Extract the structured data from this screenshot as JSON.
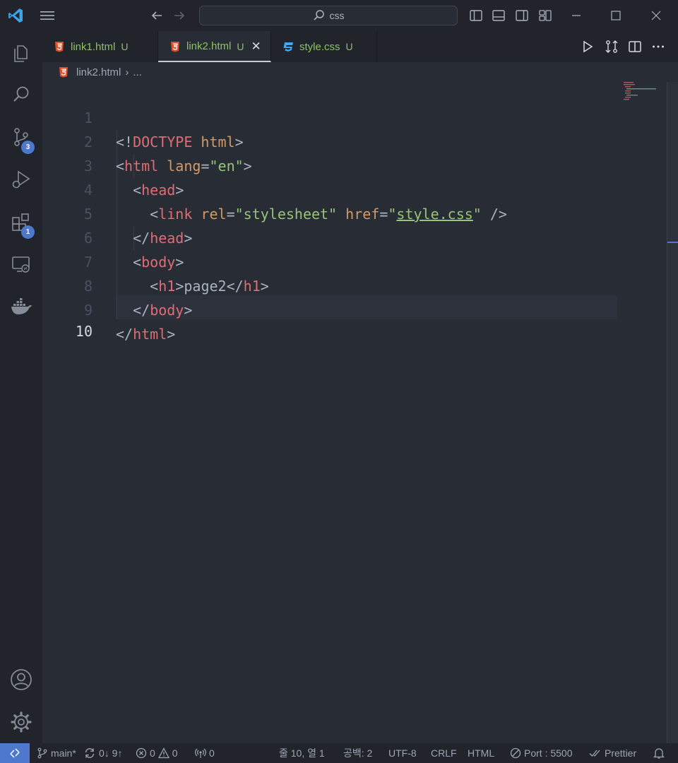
{
  "titlebar": {
    "search_text": "css"
  },
  "activity": {
    "source_control_badge": "3",
    "extensions_badge": "1"
  },
  "tabs": [
    {
      "label": "link1.html",
      "status": "U"
    },
    {
      "label": "link2.html",
      "status": "U",
      "close": "✕"
    },
    {
      "label": "style.css",
      "status": "U"
    }
  ],
  "breadcrumb": {
    "file": "link2.html",
    "separator": "›",
    "rest": "..."
  },
  "editor": {
    "line_numbers": [
      "1",
      "2",
      "3",
      "4",
      "5",
      "6",
      "7",
      "8",
      "9",
      "10"
    ],
    "tokens": {
      "l1_open": "<!",
      "l1_tag": "DOCTYPE",
      "l1_attr": " html",
      "l1_close": ">",
      "l2_open": "<",
      "l2_tag": "html",
      "l2_attr": " lang",
      "l2_eq": "=",
      "l2_str": "\"en\"",
      "l2_close": ">",
      "l3_open": "<",
      "l3_tag": "head",
      "l3_close": ">",
      "l4_open": "<",
      "l4_tag": "link",
      "l4_attr1": " rel",
      "l4_eq1": "=",
      "l4_str1": "\"stylesheet\"",
      "l4_attr2": " href",
      "l4_eq2": "=",
      "l4_q1": "\"",
      "l4_link": "style.css",
      "l4_q2": "\"",
      "l4_close": " />",
      "l5_open": "</",
      "l5_tag": "head",
      "l5_close": ">",
      "l6_open": "<",
      "l6_tag": "body",
      "l6_close": ">",
      "l7_open": "<",
      "l7_tag": "h1",
      "l7_mid1": ">",
      "l7_text": "page2",
      "l7_mid2": "</",
      "l7_tag2": "h1",
      "l7_close": ">",
      "l8_open": "</",
      "l8_tag": "body",
      "l8_close": ">",
      "l9_open": "</",
      "l9_tag": "html",
      "l9_close": ">"
    }
  },
  "statusbar": {
    "branch": "main*",
    "sync": "0↓ 9↑",
    "errors": "0",
    "warnings": "0",
    "ports": "0",
    "position": "줄 10, 열 1",
    "spaces": "공백: 2",
    "encoding": "UTF-8",
    "eol": "CRLF",
    "language": "HTML",
    "live_server": "Port : 5500",
    "formatter": "Prettier"
  },
  "colors": {
    "accent": "#4d78cc",
    "tag": "#e06c75",
    "attribute": "#d19a66",
    "string": "#98c379",
    "untracked": "#8cc265"
  }
}
